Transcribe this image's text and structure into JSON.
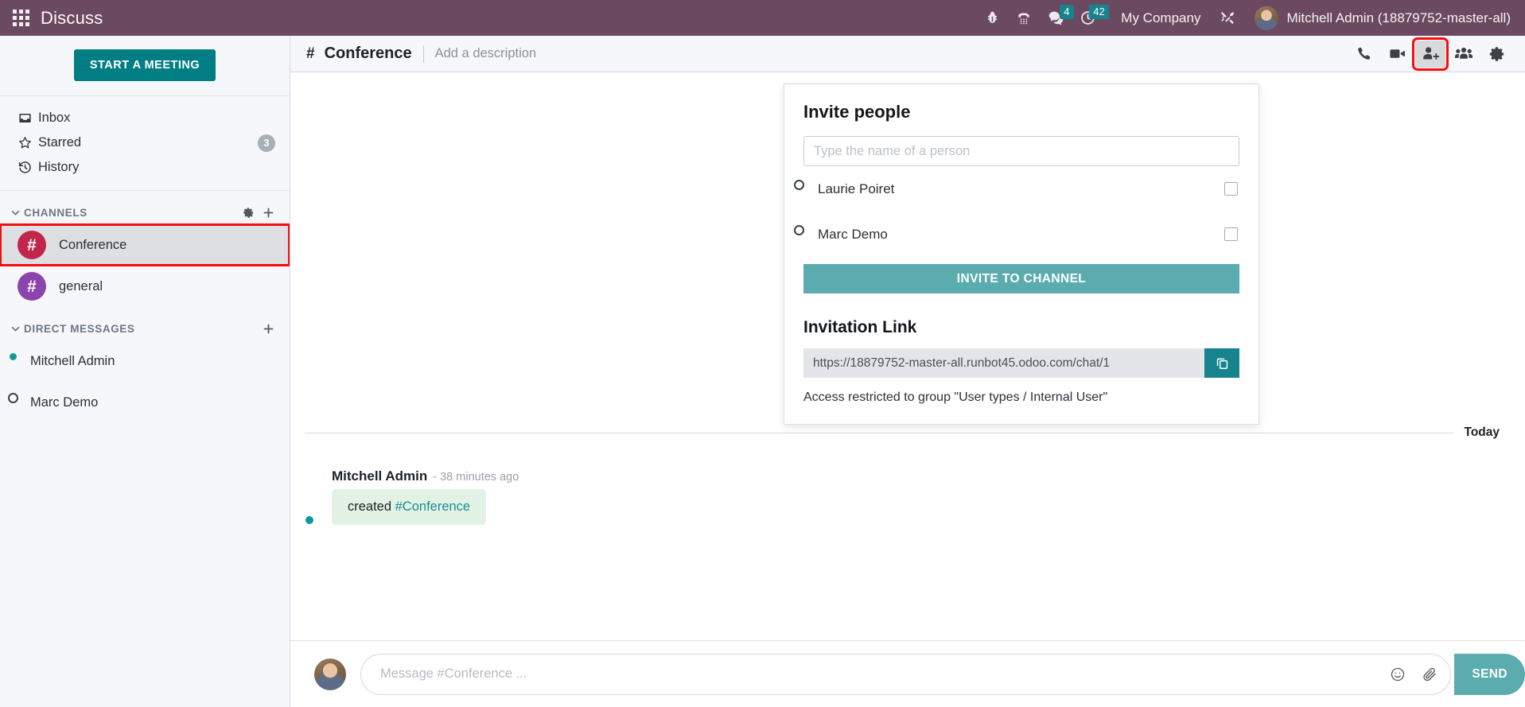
{
  "topbar": {
    "app_title": "Discuss",
    "apps_icon": "apps-grid-icon",
    "company": "My Company",
    "user": "Mitchell Admin (18879752-master-all)",
    "icons": [
      {
        "name": "bug-icon"
      },
      {
        "name": "phone-dialpad-icon"
      },
      {
        "name": "messages-icon",
        "count": "4"
      },
      {
        "name": "activities-clock-icon",
        "count": "42"
      },
      {
        "name": "tools-icon"
      }
    ]
  },
  "sidebar": {
    "start_meeting_label": "START A MEETING",
    "mailboxes": [
      {
        "label": "Inbox",
        "icon": "inbox-icon",
        "count": ""
      },
      {
        "label": "Starred",
        "icon": "star-icon",
        "count": "3"
      },
      {
        "label": "History",
        "icon": "history-icon",
        "count": ""
      }
    ],
    "channels_group": {
      "label": "CHANNELS",
      "settings_icon": "gear-icon",
      "add_icon": "plus-icon"
    },
    "channels": [
      {
        "label": "Conference",
        "color": "#c2254b",
        "active": true
      },
      {
        "label": "general",
        "color": "#8b43ad",
        "active": false
      }
    ],
    "dm_group": {
      "label": "DIRECT MESSAGES",
      "add_icon": "plus-icon"
    },
    "direct_messages": [
      {
        "label": "Mitchell Admin",
        "status": "online"
      },
      {
        "label": "Marc Demo",
        "status": "offline"
      }
    ]
  },
  "chat_header": {
    "hash": "#",
    "channel_name": "Conference",
    "description_placeholder": "Add a description",
    "actions": [
      {
        "name": "call-icon"
      },
      {
        "name": "video-call-icon"
      },
      {
        "name": "add-users-icon"
      },
      {
        "name": "members-icon"
      },
      {
        "name": "settings-gear-icon"
      }
    ]
  },
  "thread": {
    "date_separator": "Today",
    "messages": [
      {
        "author": "Mitchell Admin",
        "time": "- 38 minutes ago",
        "text": "created ",
        "link": "#Conference"
      }
    ]
  },
  "composer": {
    "placeholder": "Message #Conference ...",
    "value": "",
    "emoji_icon": "smiley-icon",
    "attach_icon": "paperclip-icon",
    "send_label": "SEND"
  },
  "invite_popover": {
    "title": "Invite people",
    "search_placeholder": "Type the name of a person",
    "search_value": "",
    "people": [
      {
        "name": "Laurie Poiret",
        "checked": false
      },
      {
        "name": "Marc Demo",
        "checked": false
      }
    ],
    "invite_button": "INVITE TO CHANNEL",
    "link_title": "Invitation Link",
    "link_value": "https://18879752-master-all.runbot45.odoo.com/chat/1",
    "copy_icon": "copy-icon",
    "access_note": "Access restricted to group \"User types / Internal User\""
  },
  "colors": {
    "topbar": "#6b4a61",
    "accent_teal": "#017e84",
    "button_teal": "#5bacae",
    "highlight_red": "#f40d0d"
  }
}
